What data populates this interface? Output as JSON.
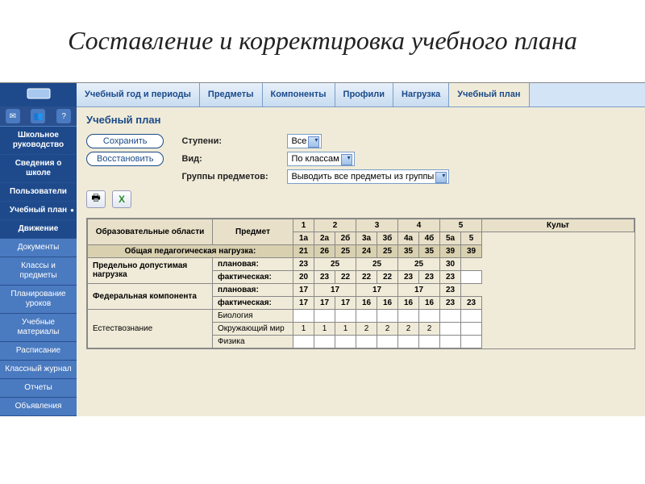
{
  "slide_title": "Составление и корректировка учебного плана",
  "sidebar": {
    "icons": [
      "✉",
      "👥",
      "?"
    ],
    "items": [
      {
        "label": "Школьное руководство",
        "k": "dark"
      },
      {
        "label": "Сведения о школе",
        "k": "dark"
      },
      {
        "label": "Пользователи",
        "k": "dark"
      },
      {
        "label": "Учебный план",
        "k": "active"
      },
      {
        "label": "Движение",
        "k": "dark"
      },
      {
        "label": "Документы",
        "k": "lt"
      },
      {
        "label": "Классы и предметы",
        "k": "lt"
      },
      {
        "label": "Планирование уроков",
        "k": "lt"
      },
      {
        "label": "Учебные материалы",
        "k": "lt"
      },
      {
        "label": "Расписание",
        "k": "lt"
      },
      {
        "label": "Классный журнал",
        "k": "lt"
      },
      {
        "label": "Отчеты",
        "k": "lt"
      },
      {
        "label": "Объявления",
        "k": "lt"
      }
    ]
  },
  "tabs": [
    "Учебный год и периоды",
    "Предметы",
    "Компоненты",
    "Профили",
    "Нагрузка",
    "Учебный план"
  ],
  "active_tab": 5,
  "content": {
    "title": "Учебный план",
    "btn_save": "Сохранить",
    "btn_restore": "Восстановить",
    "f_steps_label": "Ступени:",
    "f_steps_val": "Все",
    "f_view_label": "Вид:",
    "f_view_val": "По классам",
    "f_groups_label": "Группы предметов:",
    "f_groups_val": "Выводить все предметы из группы"
  },
  "chart_data": {
    "type": "table",
    "header_area": "Образовательные области",
    "header_subject": "Предмет",
    "header_right": "Культ",
    "groups": [
      {
        "num": "1",
        "classes": [
          "1а"
        ]
      },
      {
        "num": "2",
        "classes": [
          "2а",
          "2б"
        ]
      },
      {
        "num": "3",
        "classes": [
          "3а",
          "3б"
        ]
      },
      {
        "num": "4",
        "classes": [
          "4а",
          "4б"
        ]
      },
      {
        "num": "5",
        "classes": [
          "5а",
          "5"
        ]
      }
    ],
    "rows": [
      {
        "area": "Общая педагогическая нагрузка:",
        "subject": "",
        "style": "sect",
        "vals": [
          "21",
          "26",
          "25",
          "24",
          "25",
          "35",
          "35",
          "39",
          "39"
        ]
      },
      {
        "area": "Предельно допустимая нагрузка",
        "subject": "плановая:",
        "style": "b",
        "span": [
          [
            "23"
          ],
          [
            "25",
            "",
            true
          ],
          [
            "25",
            "",
            true
          ],
          [
            "25",
            "",
            true
          ],
          [
            "30"
          ]
        ]
      },
      {
        "area": "",
        "subject": "фактическая:",
        "style": "b",
        "vals": [
          "20",
          "23",
          "22",
          "22",
          "22",
          "23",
          "23",
          "23",
          ""
        ]
      },
      {
        "area": "Федеральная компонента",
        "subject": "плановая:",
        "style": "b",
        "span": [
          [
            "17"
          ],
          [
            "17",
            "",
            true
          ],
          [
            "17",
            "",
            true
          ],
          [
            "17",
            "",
            true
          ],
          [
            "23"
          ]
        ]
      },
      {
        "area": "",
        "subject": "фактическая:",
        "style": "b",
        "vals": [
          "17",
          "17",
          "17",
          "16",
          "16",
          "16",
          "16",
          "23",
          "23"
        ]
      },
      {
        "area": "Естествознание",
        "subject": "Биология",
        "vals": [
          "",
          "",
          "",
          "",
          "",
          "",
          "",
          "",
          ""
        ]
      },
      {
        "area": "",
        "subject": "Окружающий мир",
        "vals": [
          "1",
          "1",
          "1",
          "2",
          "2",
          "2",
          "2",
          "",
          ""
        ]
      },
      {
        "area": "",
        "subject": "Физика",
        "vals": [
          "",
          "",
          "",
          "",
          "",
          "",
          "",
          "",
          ""
        ]
      }
    ]
  }
}
